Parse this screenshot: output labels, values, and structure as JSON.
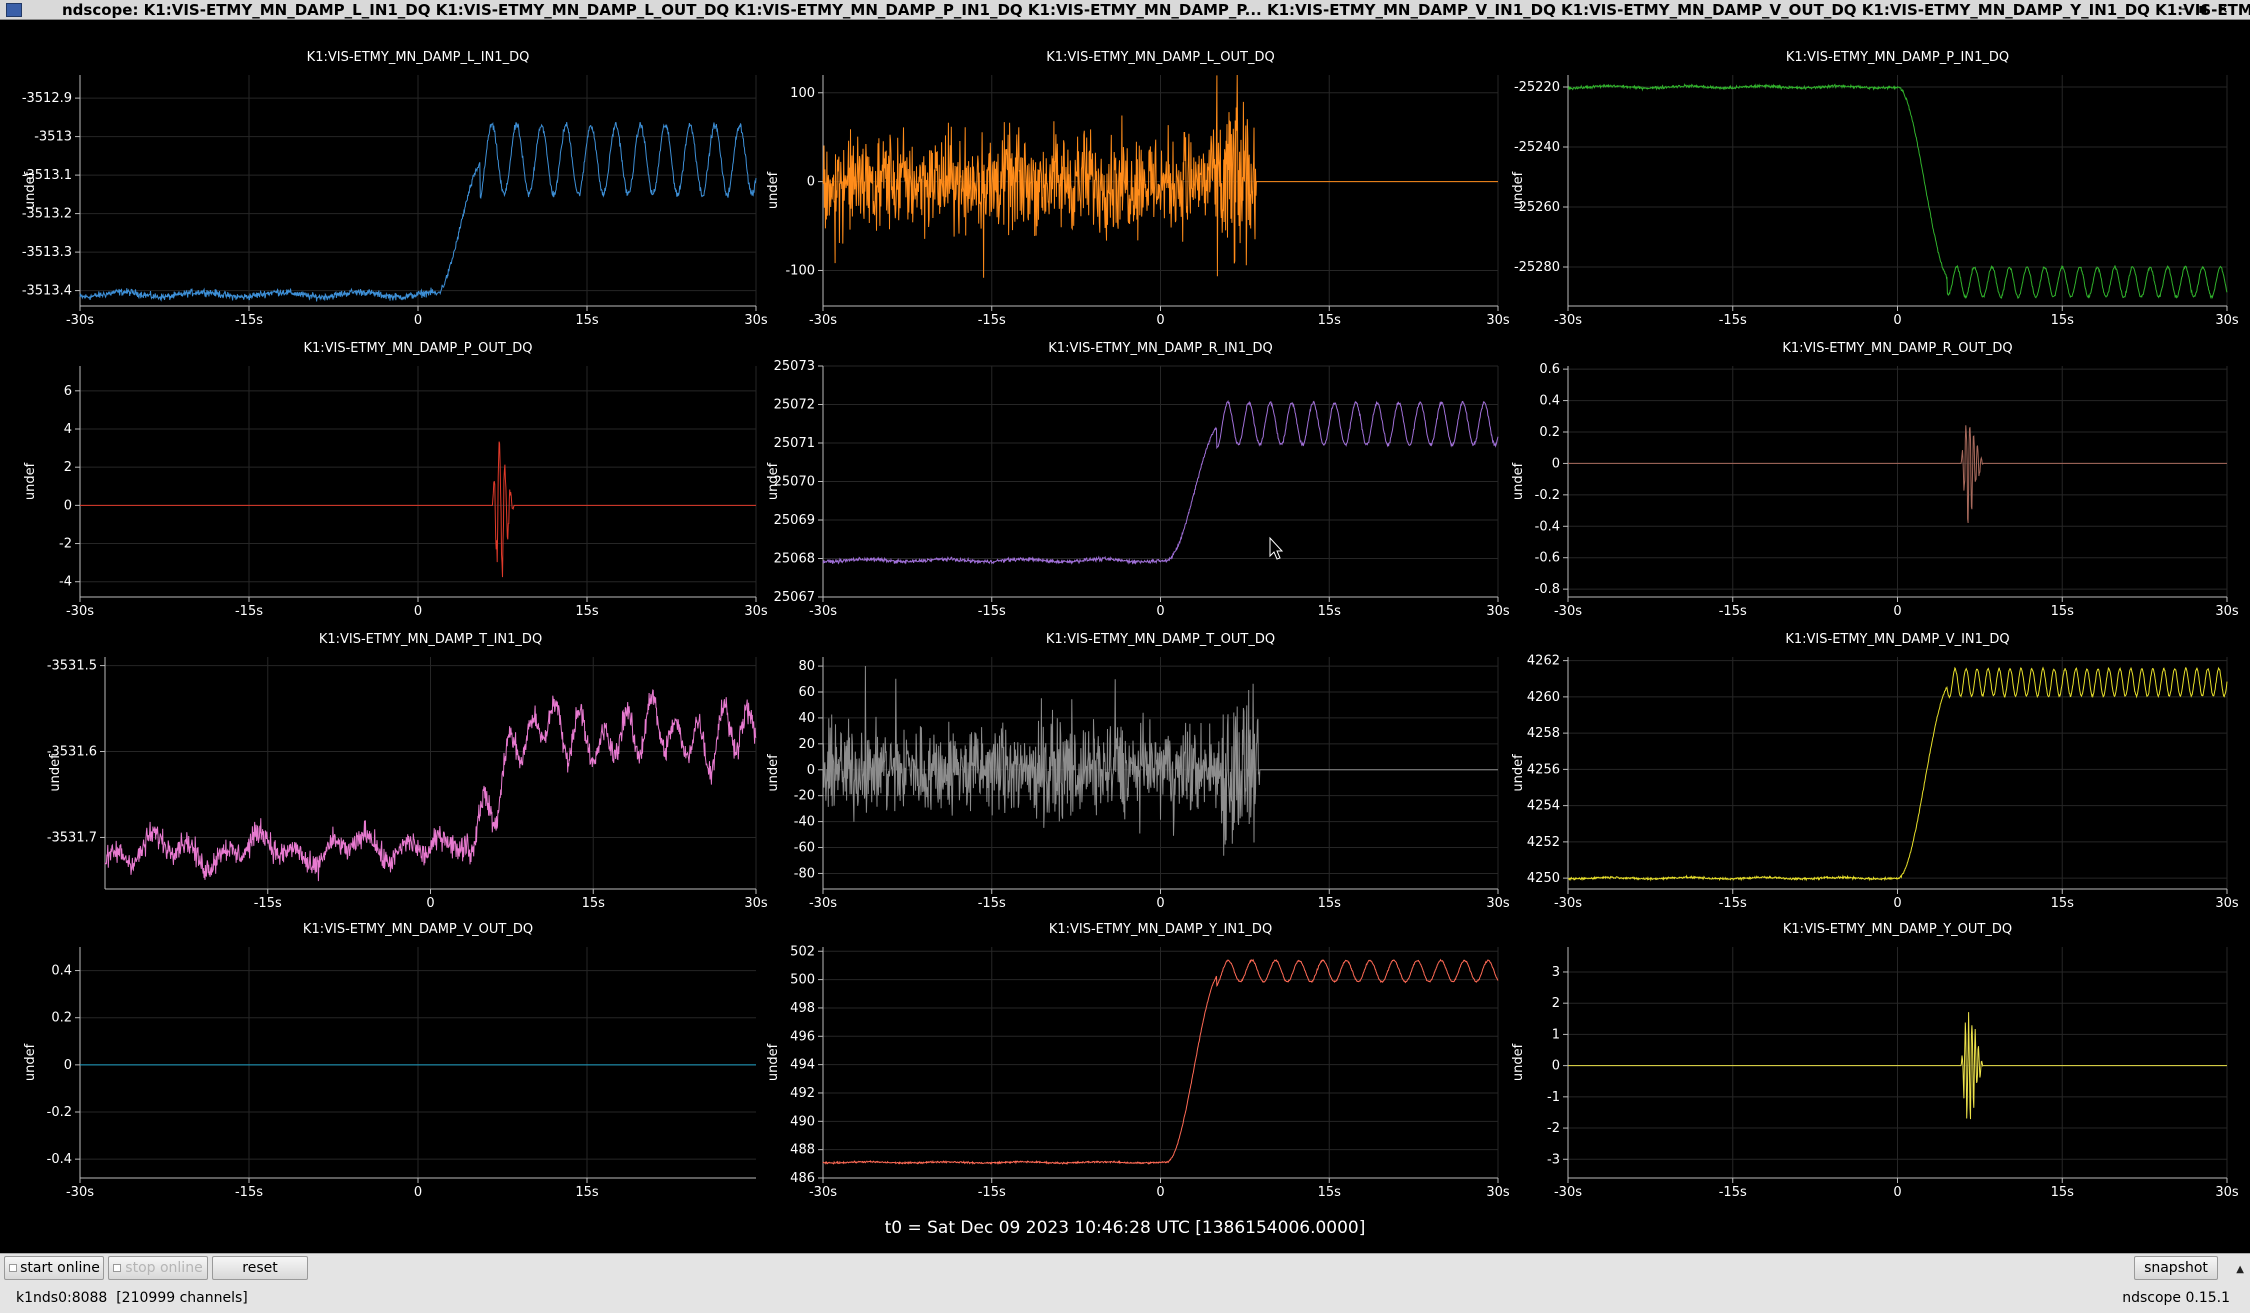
{
  "window": {
    "title": "ndscope: K1:VIS-ETMY_MN_DAMP_L_IN1_DQ K1:VIS-ETMY_MN_DAMP_L_OUT_DQ K1:VIS-ETMY_MN_DAMP_P_IN1_DQ K1:VIS-ETMY_MN_DAMP_P... K1:VIS-ETMY_MN_DAMP_V_IN1_DQ K1:VIS-ETMY_MN_DAMP_V_OUT_DQ K1:VIS-ETMY_MN_DAMP_Y_IN1_DQ K1:VIS-ETMY_MN_DAMP_Y_OUT_DQ",
    "buttons": [
      "–",
      "▪",
      "×"
    ]
  },
  "t0_label": "t0 = Sat Dec 09 2023 10:46:28 UTC [1386154006.0000]",
  "toolbar": {
    "start_online": "start online",
    "stop_online": "stop online",
    "reset": "reset",
    "snapshot": "snapshot"
  },
  "status": {
    "server": "k1nds0:8088  [210999 channels]",
    "version": "ndscope 0.15.1"
  },
  "colors": {
    "background": "#000000",
    "grid": "#262626",
    "axis": "#bbbbbb",
    "text": "#ffffff"
  },
  "chart_data": [
    {
      "type": "line",
      "title": "K1:VIS-ETMY_MN_DAMP_L_IN1_DQ",
      "ylabel": "undef",
      "color": "#3d8fd6",
      "xlim": [
        -30,
        30
      ],
      "ylim": [
        -3513.44,
        -3512.84
      ],
      "xticks": [
        "-30s",
        "-15s",
        "0",
        "15s",
        "30s"
      ],
      "yticks": [
        "-3512.9",
        "-3513",
        "-3513.1",
        "-3513.2",
        "-3513.3",
        "-3513.4"
      ],
      "signal": {
        "kind": "step",
        "base": -3513.41,
        "plateau": -3513.06,
        "t_start": 1.5,
        "t_end": 6,
        "osc_amp": 0.09,
        "osc_period": 2.2,
        "noise": 0.008
      }
    },
    {
      "type": "line",
      "title": "K1:VIS-ETMY_MN_DAMP_L_OUT_DQ",
      "ylabel": "undef",
      "color": "#ff8c1a",
      "xlim": [
        -30,
        30
      ],
      "ylim": [
        -140,
        120
      ],
      "xticks": [
        "-30s",
        "-15s",
        "0",
        "15s",
        "30s"
      ],
      "yticks": [
        "100",
        "0",
        "-100"
      ],
      "signal": {
        "kind": "noise_then_flat",
        "amp": 48,
        "t_stop": 8.5,
        "burst_amp": 110,
        "burst_t": 6.5
      }
    },
    {
      "type": "line",
      "title": "K1:VIS-ETMY_MN_DAMP_P_IN1_DQ",
      "ylabel": "undef",
      "color": "#31b22c",
      "xlim": [
        -30,
        30
      ],
      "ylim": [
        -25293,
        -25216
      ],
      "xticks": [
        "-30s",
        "-15s",
        "0",
        "15s",
        "30s"
      ],
      "yticks": [
        "-25220",
        "-25240",
        "-25260",
        "-25280"
      ],
      "signal": {
        "kind": "step",
        "base": -25220,
        "plateau": -25285,
        "t_start": 0,
        "t_end": 5,
        "osc_amp": 5,
        "osc_period": 1.6,
        "noise": 0.4
      }
    },
    {
      "type": "line",
      "title": "K1:VIS-ETMY_MN_DAMP_P_OUT_DQ",
      "ylabel": "undef",
      "color": "#e03a2a",
      "xlim": [
        -30,
        30
      ],
      "ylim": [
        -4.8,
        7.3
      ],
      "xticks": [
        "-30s",
        "-15s",
        "0",
        "15s",
        "30s"
      ],
      "yticks": [
        "6",
        "4",
        "2",
        "0",
        "-2",
        "-4"
      ],
      "signal": {
        "kind": "burst",
        "t0": 6.6,
        "dur": 2.5,
        "amp": 6.4,
        "period": 0.5,
        "noise": 0.02
      }
    },
    {
      "type": "line",
      "title": "K1:VIS-ETMY_MN_DAMP_R_IN1_DQ",
      "ylabel": "undef",
      "color": "#a070d8",
      "xlim": [
        -30,
        30
      ],
      "ylim": [
        25067,
        25073
      ],
      "xticks": [
        "-30s",
        "-15s",
        "0",
        "15s",
        "30s"
      ],
      "yticks": [
        "25073",
        "25072",
        "25071",
        "25070",
        "25069",
        "25068",
        "25067"
      ],
      "signal": {
        "kind": "step",
        "base": 25067.95,
        "plateau": 25071.5,
        "t_start": 0.5,
        "t_end": 5.5,
        "osc_amp": 0.55,
        "osc_period": 1.9,
        "noise": 0.04
      }
    },
    {
      "type": "line",
      "title": "K1:VIS-ETMY_MN_DAMP_R_OUT_DQ",
      "ylabel": "undef",
      "color": "#a86a5c",
      "xlim": [
        -30,
        30
      ],
      "ylim": [
        -0.85,
        0.62
      ],
      "xticks": [
        "-30s",
        "-15s",
        "0",
        "15s",
        "30s"
      ],
      "yticks": [
        "0.6",
        "0.4",
        "0.2",
        "0",
        "-0.2",
        "-0.4",
        "-0.6",
        "-0.8"
      ],
      "signal": {
        "kind": "burst",
        "t0": 5.8,
        "dur": 2.6,
        "amp": 0.55,
        "period": 0.35,
        "noise": 0.0
      }
    },
    {
      "type": "line",
      "title": "K1:VIS-ETMY_MN_DAMP_T_IN1_DQ",
      "ylabel": "undef",
      "color": "#e87ad0",
      "xlim": [
        -30,
        30
      ],
      "ylim": [
        -3531.76,
        -3531.49
      ],
      "xticks": [
        "-15s",
        "0",
        "15s",
        "30s"
      ],
      "yticks": [
        "-3531.5",
        "-3531.6",
        "-3531.7"
      ],
      "signal": {
        "kind": "wander",
        "base": -3531.715,
        "plateau": -3531.58,
        "t_start": 3.5,
        "t_end": 8,
        "osc_amp": 0.025,
        "osc_period": 2.2,
        "noise": 0.012
      }
    },
    {
      "type": "line",
      "title": "K1:VIS-ETMY_MN_DAMP_T_OUT_DQ",
      "ylabel": "undef",
      "color": "#8c8c8c",
      "xlim": [
        -30,
        30
      ],
      "ylim": [
        -92,
        87
      ],
      "xticks": [
        "-30s",
        "-15s",
        "0",
        "15s",
        "30s"
      ],
      "yticks": [
        "80",
        "60",
        "40",
        "20",
        "0",
        "-20",
        "-40",
        "-60",
        "-80"
      ],
      "signal": {
        "kind": "noise_then_flat",
        "amp": 30,
        "t_stop": 8.8,
        "burst_amp": 85,
        "burst_t": 6.9
      }
    },
    {
      "type": "line",
      "title": "K1:VIS-ETMY_MN_DAMP_V_IN1_DQ",
      "ylabel": "undef",
      "color": "#e8e02a",
      "xlim": [
        -30,
        30
      ],
      "ylim": [
        4249.4,
        4262.2
      ],
      "xticks": [
        "-30s",
        "-15s",
        "0",
        "15s",
        "30s"
      ],
      "yticks": [
        "4262",
        "4260",
        "4258",
        "4256",
        "4254",
        "4252",
        "4250"
      ],
      "signal": {
        "kind": "step",
        "base": 4250,
        "plateau": 4260.8,
        "t_start": 0,
        "t_end": 5,
        "osc_amp": 0.75,
        "osc_period": 1.0,
        "noise": 0.05
      }
    },
    {
      "type": "line",
      "title": "K1:VIS-ETMY_MN_DAMP_V_OUT_DQ",
      "ylabel": "undef",
      "color": "#1fa3c8",
      "xlim": [
        -30,
        30
      ],
      "ylim": [
        -0.48,
        0.5
      ],
      "xticks": [
        "-30s",
        "-15s",
        "0",
        "15s"
      ],
      "yticks": [
        "0.4",
        "0.2",
        "0",
        "-0.2",
        "-0.4"
      ],
      "signal": {
        "kind": "flat",
        "value": 0
      }
    },
    {
      "type": "line",
      "title": "K1:VIS-ETMY_MN_DAMP_Y_IN1_DQ",
      "ylabel": "undef",
      "color": "#ff6a55",
      "xlim": [
        -30,
        30
      ],
      "ylim": [
        486,
        502.3
      ],
      "xticks": [
        "-30s",
        "-15s",
        "0",
        "15s",
        "30s"
      ],
      "yticks": [
        "502",
        "500",
        "498",
        "496",
        "494",
        "492",
        "490",
        "488",
        "486"
      ],
      "signal": {
        "kind": "step",
        "base": 487.1,
        "plateau": 500.6,
        "t_start": 0.5,
        "t_end": 5.5,
        "osc_amp": 0.75,
        "osc_period": 2.1,
        "noise": 0.05
      }
    },
    {
      "type": "line",
      "title": "K1:VIS-ETMY_MN_DAMP_Y_OUT_DQ",
      "ylabel": "undef",
      "color": "#ede24a",
      "xlim": [
        -30,
        30
      ],
      "ylim": [
        -3.6,
        3.8
      ],
      "xticks": [
        "-30s",
        "-15s",
        "0",
        "15s",
        "30s"
      ],
      "yticks": [
        "3",
        "2",
        "1",
        "0",
        "-1",
        "-2",
        "-3"
      ],
      "signal": {
        "kind": "burst",
        "t0": 5.8,
        "dur": 2.6,
        "amp": 3.2,
        "period": 0.3,
        "noise": 0.0
      }
    }
  ]
}
